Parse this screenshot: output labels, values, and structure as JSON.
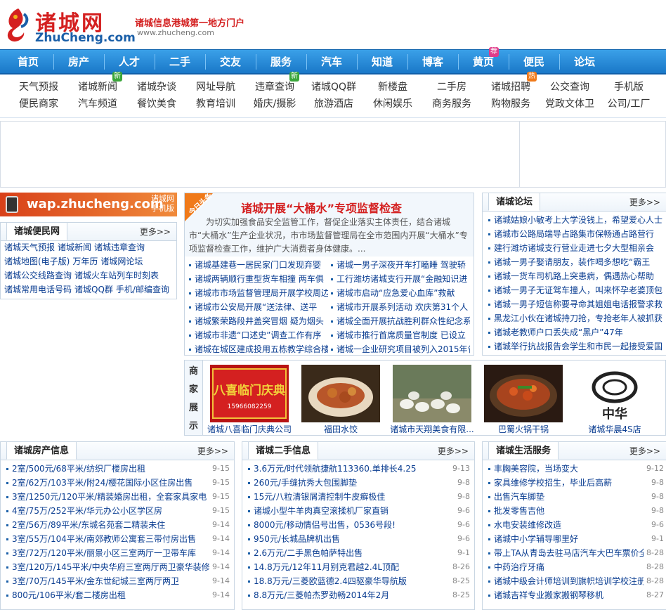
{
  "header": {
    "logo_cn": "诸城网",
    "logo_en": "ZhuCheng.com",
    "slogan": "诸城信息港城第一地方门户",
    "slogan_url": "www.zhucheng.com"
  },
  "nav": {
    "items": [
      "首页",
      "房产",
      "人才",
      "二手",
      "交友",
      "服务",
      "汽车",
      "知道",
      "博客",
      "黄页",
      "便民",
      "论坛"
    ],
    "badge_huangye": "荐"
  },
  "subnav": {
    "row1": [
      "天气预报",
      "诸城新闻",
      "诸城杂谈",
      "网址导航",
      "违章查询",
      "诸城QQ群",
      "新楼盘",
      "二手房",
      "诸城招聘",
      "公交查询",
      "手机版"
    ],
    "row2": [
      "便民商家",
      "汽车频道",
      "餐饮美食",
      "教育培训",
      "婚庆/摄影",
      "旅游酒店",
      "休闲娱乐",
      "商务服务",
      "购物服务",
      "党政文体卫",
      "公司/工厂"
    ],
    "badge_new": "新",
    "badge_hot": "热"
  },
  "wap": {
    "url": "wap.zhucheng.com",
    "sub1": "诸城网",
    "sub2": "手机版"
  },
  "convenience": {
    "title": "诸城便民网",
    "more": "更多>>",
    "rows": [
      [
        "诸城天气预报",
        "诸城新闻",
        "诸城违章查询"
      ],
      [
        "诸城地图(电子版)",
        "万年历",
        "诸城网论坛"
      ],
      [
        "诸城公交线路查询",
        "诸城火车站列车时刻表"
      ],
      [
        "诸城常用电话号码",
        "诸城QQ群",
        "手机/邮编查询"
      ]
    ]
  },
  "headline": {
    "tag": "今日头条",
    "title": "诸城开展“大桶水”专项监督检查",
    "summary": "为切实加强食品安全监管工作，督促企业落实主体责任，结合诸城市“大桶水”生产企业状况，市市场监督管理局在全市范围内开展“大桶水”专项监督检查工作，维护广大消费者身体健康。...",
    "left": [
      "诸城基建巷一居民家门口发现弃婴",
      "诸城两辆顺行重型货车相撞 两车俱",
      "诸城市市场监督管理局开展学校周边",
      "诸城市公安局开展“送法律、送平",
      "诸城繁荣路段井盖突冒烟 疑为烟头",
      "诸城市非遗“口述史”调查工作有序",
      "诸城在城区建成投用五栋教学综合楼"
    ],
    "right": [
      "诸城一男子深夜开车打瞌睡 驾驶轿",
      "工行潍坊诸城支行开展“金融知识进",
      "诸城市启动“应急爱心血库”救献",
      "诸城市开展系列活动 欢庆第31个人",
      "诸城全面开展抗战胜利群众性纪念系",
      "诸城市推行首席质量官制度 已设立",
      "诸城一企业研究项目被列入2015年省"
    ]
  },
  "forum": {
    "title": "诸城论坛",
    "more": "更多>>",
    "items": [
      "诸城姑娘小敏考上大学没钱上，希望爱心人士",
      "诸城市公路局端导占路集市保畅通占路营行",
      "建行潍坊诸城支行营业走进七夕大型相亲会",
      "诸城一男子娶请朋友，装作喝多想吃“霸王",
      "诸城一货车司机路上突患病，偶遇热心帮助",
      "诸城一男子无证驾车撞人，叫来怀孕老婆顶包",
      "诸城一男子短信称要寻命其姐姐电话报警求救",
      "黑龙江小伙在诸城持刀抢，专抢老年人被抓获",
      "诸城老教师户口丢失成“黑户”47年",
      "诸城举行抗战报告会学生和市民一起接受爱国"
    ]
  },
  "store": {
    "label": [
      "商",
      "家",
      "展",
      "示"
    ],
    "items": [
      "诸城八喜临门庆典公司",
      "福田水饺",
      "诸城市天翔美食有限...",
      "巴蜀火锅干锅",
      "诸城华晨4S店"
    ],
    "img1_text1": "八喜临门庆典",
    "img1_text2": "15966082259",
    "img5_text": "中华"
  },
  "house": {
    "title": "诸城房产信息",
    "more": "更多>>",
    "items": [
      [
        "2室/500元/68平米/纺织厂楼房出租",
        "9-15"
      ],
      [
        "2室/62万/103平米/附24/樱花国际小区住房出售",
        "9-15"
      ],
      [
        "3室/1250元/120平米/精装婚房出租，全套家具家电",
        "9-15"
      ],
      [
        "4室/75万/252平米/华元办公小区学区房",
        "9-15"
      ],
      [
        "2室/56万/89平米/东城名苑套二精装未住",
        "9-14"
      ],
      [
        "3室/55万/104平米/南郊教师公寓套三带付房出售",
        "9-14"
      ],
      [
        "3室/72万/120平米/丽景小区三室两厅一卫带车库",
        "9-14"
      ],
      [
        "3室/120万/145平米/中央华府三室两厅两卫豪华装修",
        "9-14"
      ],
      [
        "3室/70万/145平米/金东世纪城三室两厅两卫",
        "9-14"
      ],
      [
        "800元/106平米/套二楼房出租",
        "9-14"
      ]
    ]
  },
  "secondhand": {
    "title": "诸城二手信息",
    "more": "更多>>",
    "items": [
      [
        "3.6万元/时代领航捷航113360.单排长4.25",
        "9-13"
      ],
      [
        "260元/手缝抗秀大包围脚垫",
        "9-8"
      ],
      [
        "15元/八粒清银屑清控制牛皮癣极佳",
        "9-8"
      ],
      [
        "诸城小型牛羊肉真空滚揉机厂家直销",
        "9-6"
      ],
      [
        "8000元/移动情侣号出售，0536号段!",
        "9-6"
      ],
      [
        "950元/长城品牌机出售",
        "9-6"
      ],
      [
        "2.6万元/二手黑色帕萨特出售",
        "9-1"
      ],
      [
        "14.8万元/12年11月别克君越2.4L顶配",
        "8-26"
      ],
      [
        "18.8万元/三菱欧蓝德2.4四驱豪华导航版",
        "8-25"
      ],
      [
        "8.8万元/三菱帕杰罗劲畅2014年2月",
        "8-25"
      ]
    ]
  },
  "life": {
    "title": "诸城生活服务",
    "more": "更多>>",
    "items": [
      [
        "丰胸美容院，当场变大",
        "9-12"
      ],
      [
        "家具维修学校招生，毕业后高薪",
        "9-8"
      ],
      [
        "出售汽车脚垫",
        "9-8"
      ],
      [
        "批发零售吉他",
        "9-8"
      ],
      [
        "水电安装维修改造",
        "9-6"
      ],
      [
        "诸城中小学辅导哪里好",
        "9-1"
      ],
      [
        "带上TA从青岛去驻马店汽车大巴车票价全",
        "8-28"
      ],
      [
        "中药治疗牙痛",
        "8-28"
      ],
      [
        "诸城中级会计师培训到旗帜培训学校注册",
        "8-28"
      ],
      [
        "诸城吉祥专业搬家搬钢琴移机",
        "8-27"
      ]
    ]
  }
}
